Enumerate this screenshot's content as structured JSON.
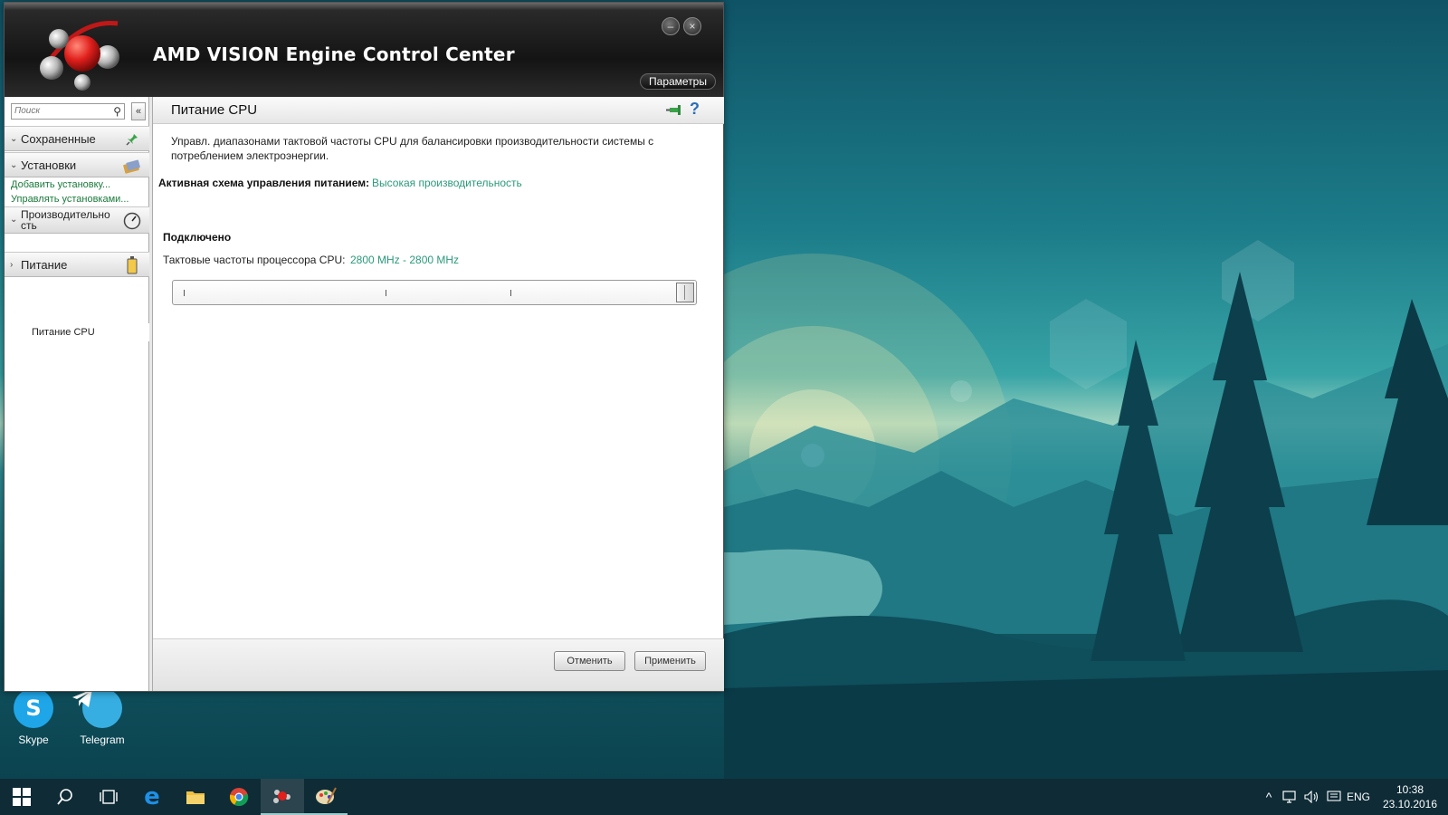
{
  "window": {
    "title": "AMD VISION Engine Control Center",
    "params_label": "Параметры",
    "minimize_glyph": "–",
    "close_glyph": "×"
  },
  "sidebar": {
    "search_placeholder": "Поиск",
    "collapse_glyph": "«",
    "saved_label": "Сохраненные",
    "installs_label": "Установки",
    "add_install_link": "Добавить установку...",
    "manage_installs_link": "Управлять установками...",
    "performance_label_line1": "Производительно",
    "performance_label_line2": "сть",
    "cpu_power_item": "Питание CPU",
    "power_label": "Питание",
    "chevron_down": "⌄",
    "chevron_right": "›"
  },
  "content": {
    "title": "Питание CPU",
    "help_glyph": "?",
    "description": "Управл. диапазонами тактовой частоты CPU для балансировки производительности системы с потреблением электроэнергии.",
    "scheme_label": "Активная схема управления питанием:",
    "scheme_value": "Высокая производительность",
    "connected_label": "Подключено",
    "freq_label": "Тактовые частоты процессора CPU:",
    "freq_value": "2800 MHz - 2800 MHz",
    "slider_position": 1.0,
    "cancel_label": "Отменить",
    "apply_label": "Применить"
  },
  "desktop": {
    "icons": [
      {
        "label": "Skype",
        "icon": "skype-icon",
        "color": "#1fa6e8"
      },
      {
        "label": "Telegram",
        "icon": "telegram-icon",
        "color": "#37aee2"
      }
    ]
  },
  "taskbar": {
    "items": [
      "start-icon",
      "search-icon",
      "task-view-icon",
      "edge-icon",
      "file-explorer-icon",
      "chrome-icon",
      "amd-vision-icon",
      "paint-icon"
    ],
    "language": "ENG",
    "time": "10:38",
    "date": "23.10.2016"
  },
  "colors": {
    "accent_green": "#2a9a7a",
    "link_green": "#1a7a3a",
    "titlebar_dark": "#141414",
    "taskbar": "#0e2b36"
  }
}
